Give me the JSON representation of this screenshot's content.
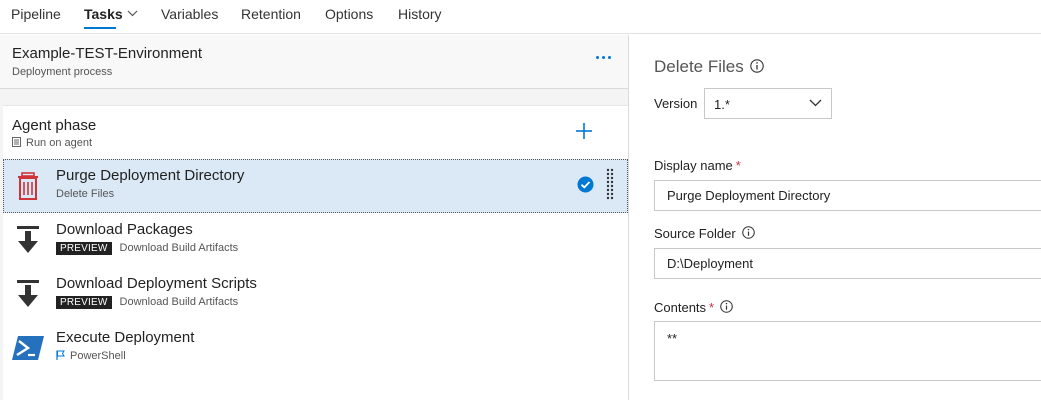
{
  "nav": {
    "tabs": [
      {
        "label": "Pipeline"
      },
      {
        "label": "Tasks"
      },
      {
        "label": "Variables"
      },
      {
        "label": "Retention"
      },
      {
        "label": "Options"
      },
      {
        "label": "History"
      }
    ],
    "active_tab": "Tasks"
  },
  "environment": {
    "title": "Example-TEST-Environment",
    "subtitle": "Deployment process"
  },
  "phase": {
    "title": "Agent phase",
    "subtitle": "Run on agent"
  },
  "tasks": [
    {
      "name": "Purge Deployment Directory",
      "subtitle": "Delete Files",
      "badge": "",
      "icon": "trash-icon",
      "selected": true
    },
    {
      "name": "Download Packages",
      "subtitle": "Download Build Artifacts",
      "badge": "PREVIEW",
      "icon": "download-icon"
    },
    {
      "name": "Download Deployment Scripts",
      "subtitle": "Download Build Artifacts",
      "badge": "PREVIEW",
      "icon": "download-icon"
    },
    {
      "name": "Execute Deployment",
      "subtitle": "PowerShell",
      "badge": "",
      "icon": "powershell-icon"
    }
  ],
  "details": {
    "title": "Delete Files",
    "version_label": "Version",
    "version_value": "1.*",
    "display_name_label": "Display name",
    "display_name_required": "*",
    "display_name_value": "Purge Deployment Directory",
    "source_folder_label": "Source Folder",
    "source_folder_value": "D:\\Deployment",
    "contents_label": "Contents",
    "contents_required": "*",
    "contents_value": "**"
  },
  "colors": {
    "accent": "#0078d4",
    "selected_row": "#dbe9f7",
    "trash_red": "#d13438",
    "required": "#c4314b"
  }
}
